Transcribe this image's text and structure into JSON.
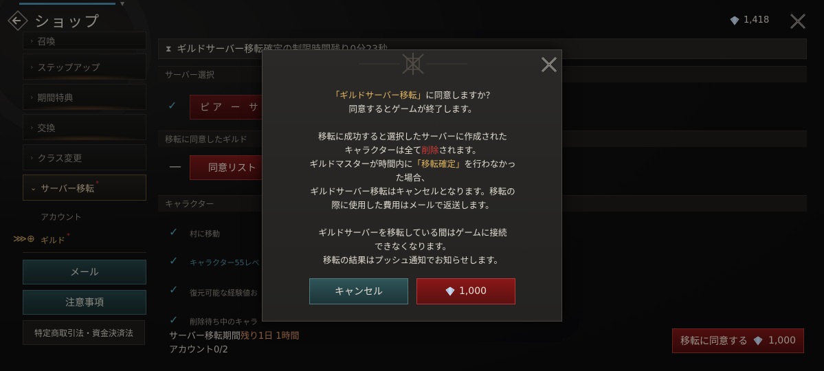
{
  "header": {
    "title": "ショップ",
    "currency_amount": "1,418",
    "back_icon": "back-arrow-icon",
    "close_icon": "close-icon"
  },
  "sidebar": {
    "items": [
      {
        "label": "召喚"
      },
      {
        "label": "ステップアップ"
      },
      {
        "label": "期間特典"
      },
      {
        "label": "交換"
      },
      {
        "label": "クラス変更"
      },
      {
        "label": "サーバー移転",
        "active": true,
        "badge": "*"
      }
    ],
    "sub_items": [
      {
        "label": "アカウント"
      },
      {
        "label": "ギルド",
        "badge": "*"
      }
    ],
    "buttons": {
      "mail": "メール",
      "notice": "注意事項",
      "legal": "特定商取引法・資金決済法"
    }
  },
  "main": {
    "banner": "ギルドサーバー移転確定の制限時間残り0分23秒",
    "server_section": "サーバー選択",
    "server_button": "ピア ー サル",
    "agree_section": "移転に同意したギルド",
    "agree_button": "同意リスト",
    "character_section": "キャラクター",
    "character_rows": [
      "村に移動",
      "キャラクター55レベ",
      "復元可能な経験値お",
      "削除待ち中のキャラ"
    ],
    "footer": {
      "period_label": "サーバー移転期間",
      "period_value": "残り1日 1時間",
      "account_label": "アカウント0/2"
    },
    "transfer_button": {
      "label": "移転に同意する",
      "cost": "1,000"
    }
  },
  "modal": {
    "line1_pre": "「ギルドサーバー移転」",
    "line1_post": "に同意しますか？",
    "line2": "同意するとゲームが終了します。",
    "p2_line1": "移転に成功すると選択したサーバーに作成された",
    "p2_line2_pre": "キャラクターは全て",
    "p2_line2_red": "削除",
    "p2_line2_post": "されます。",
    "p2_line3_pre": "ギルドマスターが時間内に",
    "p2_line3_hl": "「移転確定」",
    "p2_line3_post": "を行わなかっ",
    "p2_line4": "た場合、",
    "p2_line5": "ギルドサーバー移転はキャンセルとなります。移転の",
    "p2_line6": "際に使用した費用はメールで返送します。",
    "p3_line1": "ギルドサーバーを移転している間はゲームに接続",
    "p3_line2": "できなくなります。",
    "p3_line3": "移転の結果はプッシュ通知でお知らせします。",
    "cancel": "キャンセル",
    "confirm_cost": "1,000",
    "gem_icon": "diamond-icon",
    "colors": {
      "highlight": "#e0b662",
      "danger": "#d13a3a",
      "teal": "#2f5559",
      "crimson": "#8a1818"
    }
  }
}
